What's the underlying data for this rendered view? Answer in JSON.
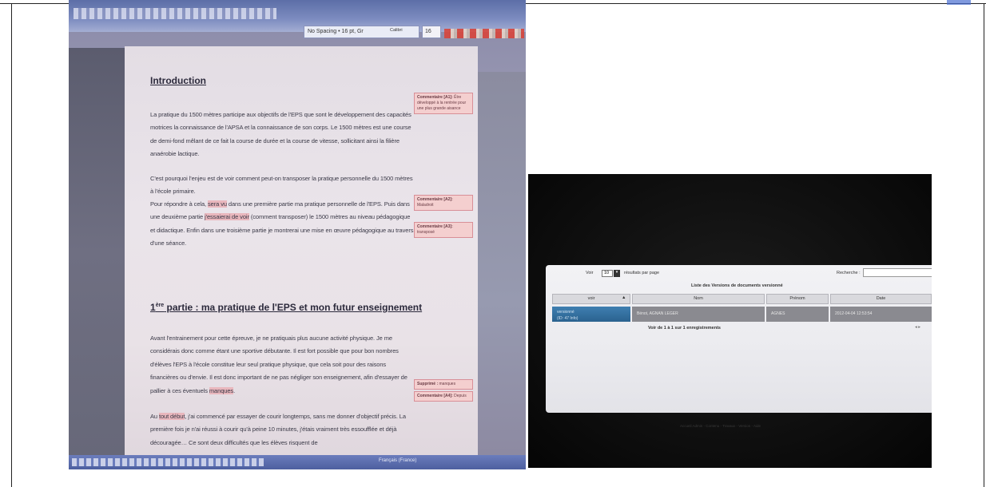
{
  "left_photo": {
    "style_box": "No Spacing • 16 pt, Gr",
    "font_name": "Calibri",
    "font_size": "16",
    "introduction": {
      "heading": "Introduction",
      "p1": "La pratique du 1500 mètres participe aux objectifs de l'EPS que sont le développement des capacités motrices la connaissance de l'APSA et la connaissance de son corps. Le 1500 mètres est une course de demi-fond mêlant de ce fait la course de durée et la course de vitesse, sollicitant ainsi la filière anaérobie lactique.",
      "p2": "C'est pourquoi l'enjeu est de voir comment peut-on transposer la pratique personnelle du 1500 mètres à l'école primaire.",
      "p3_a": "Pour répondre à cela, ",
      "p3_hl1": "sera vu",
      "p3_b": " dans une première partie ma pratique personnelle de l'EPS. Puis dans une deuxième partie ",
      "p3_hl2": "j'essaierai de voir",
      "p3_c": " (comment transposer) le 1500 mètres au niveau pédagogique et didactique. Enfin dans une troisième partie je montrerai une mise en œuvre pédagogique au travers d'une séance."
    },
    "part1": {
      "heading_prefix": "1",
      "heading_sup": "ère",
      "heading_rest": " partie : ma pratique de l'EPS et mon futur enseignement",
      "p1_a": "Avant l'entrainement pour cette épreuve, je ne pratiquais plus aucune activité physique. Je me considérais donc comme étant une sportive débutante. Il est fort possible que pour bon nombres d'élèves l'EPS à l'école constitue leur seul pratique physique, que cela soit pour des raisons financières ou d'envie. Il est donc important de ne pas négliger son enseignement, afin d'essayer de pallier à ces éventuels ",
      "p1_hl": "manques",
      "p1_b": ".",
      "p2_a": "Au ",
      "p2_hl": "tout début",
      "p2_b": ", j'ai commencé par essayer de courir longtemps, sans me donner d'objectif précis. La première fois je n'ai réussi à courir qu'à peine 10 minutes, j'étais vraiment très essoufflée et déjà découragée… Ce sont deux difficultés que les élèves risquent de"
    },
    "comments": [
      {
        "author": "Commentaire [A1]:",
        "text": "Être développé à la rentrée pour une plus grande aisance"
      },
      {
        "author": "Commentaire [A2]:",
        "text": "Maladroit"
      },
      {
        "author": "Commentaire [A3]:",
        "text": "transposé"
      },
      {
        "author": "Supprimé :",
        "text": "manques"
      },
      {
        "author": "Commentaire [A4]:",
        "text": "Depuis"
      }
    ],
    "status_label": "Français (France)"
  },
  "right_photo": {
    "show_prefix": "Voir",
    "page_size": "10",
    "show_suffix": "résultats par page",
    "table_title": "Liste des Versions de documents versionné",
    "search_label": "Recherche :",
    "columns": [
      "voir",
      "Nom",
      "Prénom",
      "Date"
    ],
    "rows": [
      {
        "voir": "versionné",
        "voir_sub": "(ID: 47 Info)",
        "nom": "Bénot, AGNAN LEGER",
        "prenom": "AGNES",
        "date": "2012-04-04 12:53:54"
      }
    ],
    "info": "Voir de 1 à 1 sur 1 enregistrements",
    "footer": "Accueil Admin - Contenu - Travaux - Version - Aide"
  }
}
